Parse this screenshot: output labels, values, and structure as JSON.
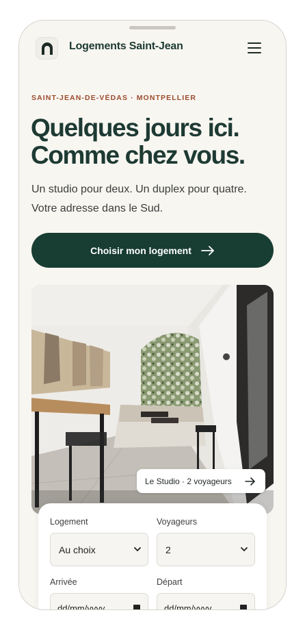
{
  "header": {
    "brand": "Logements Saint-Jean",
    "menu_icon": "hamburger-menu-icon",
    "logo_icon": "arch-logo-icon"
  },
  "hero": {
    "eyebrow": "SAINT-JEAN-DE-VÉDAS · MONTPELLIER",
    "headline_line1": "Quelques jours ici.",
    "headline_line2": "Comme chez vous.",
    "sub_line1": "Un studio pour deux. Un duplex pour quatre.",
    "sub_line2": "Votre adresse dans le Sud.",
    "cta_label": "Choisir mon logement"
  },
  "photo": {
    "badge_label": "Le Studio · 2 voyageurs"
  },
  "booking": {
    "logement_label": "Logement",
    "logement_value": "Au choix",
    "voyageurs_label": "Voyageurs",
    "voyageurs_value": "2",
    "arrivee_label": "Arrivée",
    "arrivee_placeholder": "dd/mm/yyyy",
    "depart_label": "Départ",
    "depart_placeholder": "dd/mm/yyyy"
  },
  "colors": {
    "primary": "#183d33",
    "accent": "#9b4a2c",
    "background": "#f8f6f1"
  }
}
